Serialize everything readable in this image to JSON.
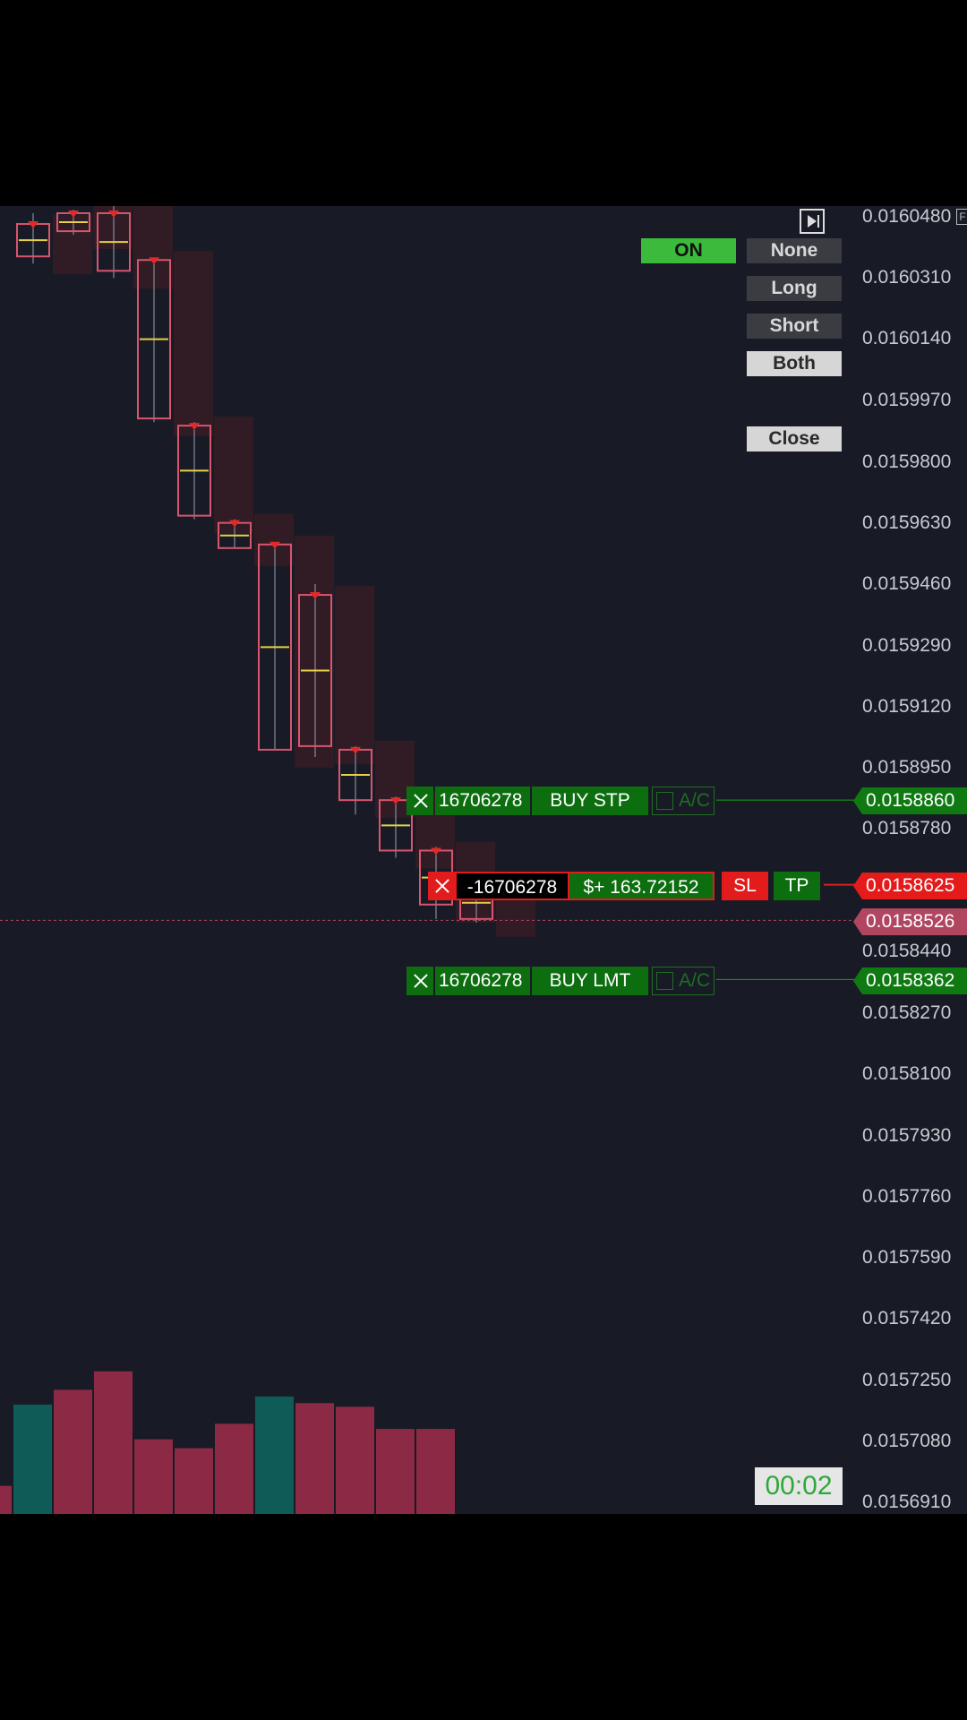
{
  "toolbar": {
    "on_label": "ON",
    "none_label": "None",
    "long_label": "Long",
    "short_label": "Short",
    "both_label": "Both",
    "close_label": "Close"
  },
  "price_axis": {
    "labels": [
      "0.0160480",
      "0.0160310",
      "0.0160140",
      "0.0159970",
      "0.0159800",
      "0.0159630",
      "0.0159460",
      "0.0159290",
      "0.0159120",
      "0.0158950",
      "0.0158780",
      "0.0158440",
      "0.0158270",
      "0.0158100",
      "0.0157930",
      "0.0157760",
      "0.0157590",
      "0.0157420",
      "0.0157250",
      "0.0157080",
      "0.0156910"
    ],
    "flags": {
      "buy_stp": "0.0158860",
      "position": "0.0158625",
      "current": "0.0158526",
      "buy_lmt": "0.0158362"
    },
    "flag_colors": {
      "buy": "#0f7a12",
      "position": "#e51b1b",
      "current": "#b04660"
    }
  },
  "orders": {
    "buy_stp": {
      "qty": "16706278",
      "type": "BUY STP",
      "ac": "A/C"
    },
    "position": {
      "qty": "-16706278",
      "pnl": "$+ 163.72152",
      "sl": "SL",
      "tp": "TP"
    },
    "buy_lmt": {
      "qty": "16706278",
      "type": "BUY LMT",
      "ac": "A/C"
    }
  },
  "timer": "00:02",
  "corner_letter": "F",
  "colors": {
    "background": "#181b25",
    "volume_down": "#8c2a45",
    "volume_up": "#0e5b57",
    "on_green": "#3cba3c",
    "order_green": "#0d6e10",
    "sl_red": "#e21c1c"
  },
  "volume_bars": [
    {
      "vol": 38,
      "up": false
    },
    {
      "vol": 148,
      "up": true
    },
    {
      "vol": 168,
      "up": false
    },
    {
      "vol": 193,
      "up": false
    },
    {
      "vol": 101,
      "up": false
    },
    {
      "vol": 89,
      "up": false
    },
    {
      "vol": 122,
      "up": false
    },
    {
      "vol": 159,
      "up": true
    },
    {
      "vol": 150,
      "up": false
    },
    {
      "vol": 145,
      "up": false
    },
    {
      "vol": 115,
      "up": false
    },
    {
      "vol": 115,
      "up": false
    }
  ],
  "candles": [
    {
      "o": 0.016046,
      "c": 0.016037,
      "h": 0.016049,
      "l": 0.016035
    },
    {
      "o": 0.016049,
      "c": 0.016044,
      "h": 0.01605,
      "l": 0.016043
    },
    {
      "o": 0.016049,
      "c": 0.016033,
      "h": 0.016051,
      "l": 0.016031
    },
    {
      "o": 0.016036,
      "c": 0.015992,
      "h": 0.016036,
      "l": 0.015991
    },
    {
      "o": 0.01599,
      "c": 0.015965,
      "h": 0.015991,
      "l": 0.015964
    },
    {
      "o": 0.015963,
      "c": 0.015956,
      "h": 0.015964,
      "l": 0.015956
    },
    {
      "o": 0.015957,
      "c": 0.0159,
      "h": 0.015957,
      "l": 0.0159
    },
    {
      "o": 0.015943,
      "c": 0.015901,
      "h": 0.015946,
      "l": 0.015898
    },
    {
      "o": 0.0159,
      "c": 0.015886,
      "h": 0.015901,
      "l": 0.015882
    },
    {
      "o": 0.015886,
      "c": 0.015872,
      "h": 0.015887,
      "l": 0.01587
    },
    {
      "o": 0.015872,
      "c": 0.015857,
      "h": 0.015873,
      "l": 0.015853
    },
    {
      "o": 0.015862,
      "c": 0.015853,
      "h": 0.015862,
      "l": 0.015852
    }
  ]
}
